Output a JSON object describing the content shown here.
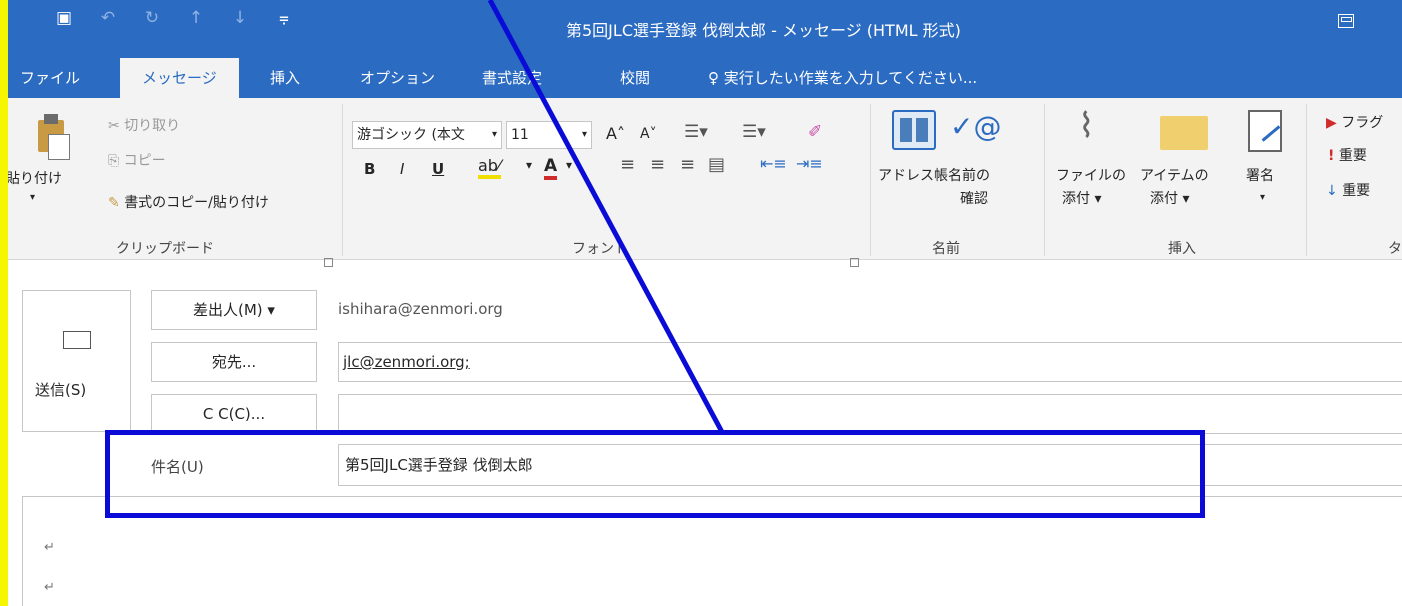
{
  "window": {
    "title": "第5回JLC選手登録  伐倒太郎 - メッセージ (HTML 形式)"
  },
  "tabs": [
    {
      "label": "ファイル"
    },
    {
      "label": "メッセージ"
    },
    {
      "label": "挿入"
    },
    {
      "label": "オプション"
    },
    {
      "label": "書式設定"
    },
    {
      "label": "校閲"
    }
  ],
  "tell_me": "♀ 実行したい作業を入力してください...",
  "ribbon": {
    "clipboard": {
      "paste": "貼り付け",
      "cut": "切り取り",
      "copy": "コピー",
      "format_painter": "書式のコピー/貼り付け",
      "group_label": "クリップボード"
    },
    "font": {
      "font_name": "游ゴシック (本文",
      "font_size": "11",
      "group_label": "フォント"
    },
    "names": {
      "address_book": "アドレス帳",
      "check_names_1": "名前の",
      "check_names_2": "確認",
      "group_label": "名前"
    },
    "include": {
      "attach_file_1": "ファイルの",
      "attach_file_2": "添付 ▾",
      "attach_item_1": "アイテムの",
      "attach_item_2": "添付 ▾",
      "signature": "署名",
      "group_label": "挿入"
    },
    "tags": {
      "follow_up": "フラグ",
      "high_importance": "重要",
      "low_importance": "重要",
      "group_label": "タグ"
    }
  },
  "compose": {
    "send_label": "送信(S)",
    "from_button": "差出人(M) ▾",
    "from_value": "ishihara@zenmori.org",
    "to_button": "宛先...",
    "to_value": "jlc@zenmori.org;",
    "cc_button": "C C(C)...",
    "cc_value": "",
    "subject_label": "件名(U)",
    "subject_value": "第5回JLC選手登録  伐倒太郎",
    "body_marks": [
      "↵",
      "↵"
    ]
  },
  "colors": {
    "title_bar": "#2b6bc1",
    "annotation": "#0b0bd8",
    "background_margin": "#f6f600"
  }
}
